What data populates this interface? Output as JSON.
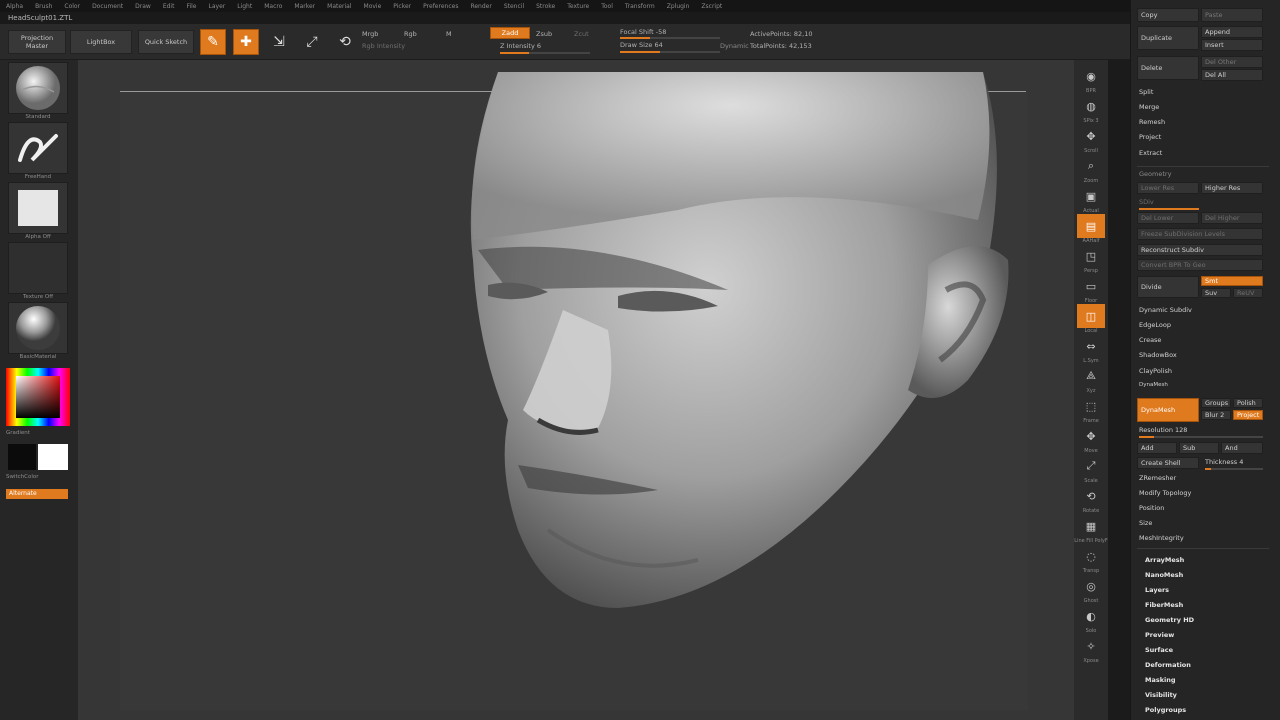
{
  "menubar": [
    "Alpha",
    "Brush",
    "Color",
    "Document",
    "Draw",
    "Edit",
    "File",
    "Layer",
    "Light",
    "Macro",
    "Marker",
    "Material",
    "Movie",
    "Picker",
    "Preferences",
    "Render",
    "Stencil",
    "Stroke",
    "Texture",
    "Tool",
    "Transform",
    "Zplugin",
    "Zscript"
  ],
  "title": "HeadSculpt01.ZTL",
  "toolbar": {
    "projection_master": "Projection Master",
    "lightbox": "LightBox",
    "quick_sketch": "Quick Sketch",
    "edit": "Edit",
    "draw": "Draw",
    "move": "Move",
    "scale": "Scale",
    "rotate": "Rotate",
    "mrgb": "Mrgb",
    "rgb": "Rgb",
    "m": "M",
    "rgb_intensity": "Rgb Intensity",
    "zadd": "Zadd",
    "zsub": "Zsub",
    "zcut": "Zcut",
    "z_intensity": "Z Intensity 6",
    "focal_shift": "Focal Shift -58",
    "draw_size": "Draw Size 64",
    "dynamic": "Dynamic",
    "active_points": "ActivePoints: 82,10",
    "total_points": "TotalPoints: 42,153",
    "colors": {
      "accent": "#e07a1e",
      "bg": "#2a2a2a",
      "canvas": "#383838"
    }
  },
  "leftshelf": {
    "brush_label": "Standard",
    "stroke_label": "FreeHand",
    "alpha_label": "Alpha Off",
    "texture_label": "Texture Off",
    "material_label": "BasicMaterial",
    "gradient_label": "Gradient",
    "switch_color": "SwitchColor",
    "alternate": "Alternate"
  },
  "rightshelf": [
    {
      "icon": "bpr-icon",
      "label": "BPR"
    },
    {
      "icon": "spix-icon",
      "label": "SPix 3"
    },
    {
      "icon": "scroll-icon",
      "label": "Scroll"
    },
    {
      "icon": "zoom-icon",
      "label": "Zoom"
    },
    {
      "icon": "actual-icon",
      "label": "Actual"
    },
    {
      "icon": "aahalf-icon",
      "label": "AAHalf"
    },
    {
      "icon": "persp-icon",
      "label": "Persp"
    },
    {
      "icon": "floor-icon",
      "label": "Floor"
    },
    {
      "icon": "local-icon",
      "label": "Local"
    },
    {
      "icon": "lsym-icon",
      "label": "L.Sym"
    },
    {
      "icon": "xyz-icon",
      "label": "Xyz"
    },
    {
      "icon": "frame-icon",
      "label": "Frame"
    },
    {
      "icon": "move-icon",
      "label": "Move"
    },
    {
      "icon": "zoom3d-icon",
      "label": "Scale"
    },
    {
      "icon": "rotate-icon",
      "label": "Rotate"
    },
    {
      "icon": "linefill-icon",
      "label": "Line Fill PolyF"
    },
    {
      "icon": "transp-icon",
      "label": "Transp"
    },
    {
      "icon": "ghost-icon",
      "label": "Ghost"
    },
    {
      "icon": "solo-icon",
      "label": "Solo"
    },
    {
      "icon": "xpose-icon",
      "label": "Xpose"
    }
  ],
  "rightpanel": {
    "copy": "Copy",
    "paste": "Paste",
    "duplicate": "Duplicate",
    "append": "Append",
    "insert": "Insert",
    "delete": "Delete",
    "del_other": "Del Other",
    "del_all": "Del All",
    "split": "Split",
    "merge": "Merge",
    "remesh": "Remesh",
    "project": "Project",
    "extract": "Extract",
    "geometry": "Geometry",
    "lower_res": "Lower Res",
    "higher_res": "Higher Res",
    "sdiv": "SDiv",
    "del_lower": "Del Lower",
    "del_higher": "Del Higher",
    "freeze_subdiv": "Freeze SubDivision Levels",
    "reconstruct_subdiv": "Reconstruct Subdiv",
    "convert_bpr": "Convert BPR To Geo",
    "divide": "Divide",
    "smt": "Smt",
    "suv": "Suv",
    "rsmt": "ReUV",
    "dynamic_subdiv": "Dynamic Subdiv",
    "edgeloop": "EdgeLoop",
    "crease": "Crease",
    "shadowbox": "ShadowBox",
    "claypolish": "ClayPolish",
    "dynamesh_section": "DynaMesh",
    "dynamesh": "DynaMesh",
    "groups": "Groups",
    "polish": "Polish",
    "blur": "Blur 2",
    "project_btn": "Project",
    "resolution": "Resolution 128",
    "add": "Add",
    "sub": "Sub",
    "and": "And",
    "create_shell": "Create Shell",
    "thickness": "Thickness 4",
    "zremesher": "ZRemesher",
    "modify_topology": "Modify Topology",
    "position": "Position",
    "size": "Size",
    "meshintegrity": "MeshIntegrity",
    "sections": [
      "ArrayMesh",
      "NanoMesh",
      "Layers",
      "FiberMesh",
      "Geometry HD",
      "Preview",
      "Surface",
      "Deformation",
      "Masking",
      "Visibility",
      "Polygroups"
    ]
  }
}
